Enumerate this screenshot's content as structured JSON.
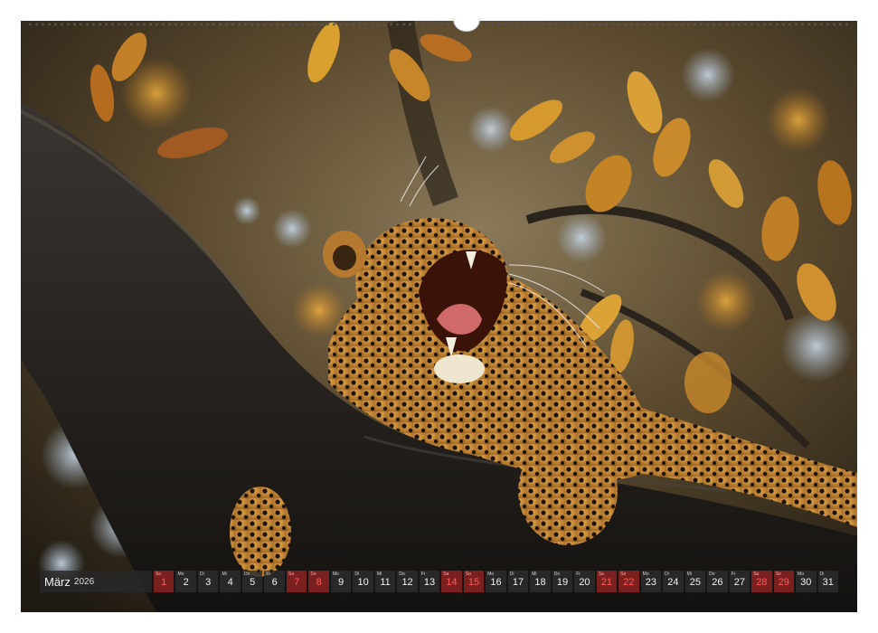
{
  "calendar": {
    "month": "März",
    "year": "2026",
    "days": [
      {
        "wd": "So",
        "num": "1",
        "sunday": true
      },
      {
        "wd": "Mo",
        "num": "2",
        "sunday": false
      },
      {
        "wd": "Di",
        "num": "3",
        "sunday": false
      },
      {
        "wd": "Mi",
        "num": "4",
        "sunday": false
      },
      {
        "wd": "Do",
        "num": "5",
        "sunday": false
      },
      {
        "wd": "Fr",
        "num": "6",
        "sunday": false
      },
      {
        "wd": "Sa",
        "num": "7",
        "sunday": true
      },
      {
        "wd": "So",
        "num": "8",
        "sunday": true
      },
      {
        "wd": "Mo",
        "num": "9",
        "sunday": false
      },
      {
        "wd": "Di",
        "num": "10",
        "sunday": false
      },
      {
        "wd": "Mi",
        "num": "11",
        "sunday": false
      },
      {
        "wd": "Do",
        "num": "12",
        "sunday": false
      },
      {
        "wd": "Fr",
        "num": "13",
        "sunday": false
      },
      {
        "wd": "Sa",
        "num": "14",
        "sunday": true
      },
      {
        "wd": "So",
        "num": "15",
        "sunday": true
      },
      {
        "wd": "Mo",
        "num": "16",
        "sunday": false
      },
      {
        "wd": "Di",
        "num": "17",
        "sunday": false
      },
      {
        "wd": "Mi",
        "num": "18",
        "sunday": false
      },
      {
        "wd": "Do",
        "num": "19",
        "sunday": false
      },
      {
        "wd": "Fr",
        "num": "20",
        "sunday": false
      },
      {
        "wd": "Sa",
        "num": "21",
        "sunday": true
      },
      {
        "wd": "So",
        "num": "22",
        "sunday": true
      },
      {
        "wd": "Mo",
        "num": "23",
        "sunday": false
      },
      {
        "wd": "Di",
        "num": "24",
        "sunday": false
      },
      {
        "wd": "Mi",
        "num": "25",
        "sunday": false
      },
      {
        "wd": "Do",
        "num": "26",
        "sunday": false
      },
      {
        "wd": "Fr",
        "num": "27",
        "sunday": false
      },
      {
        "wd": "Sa",
        "num": "28",
        "sunday": true
      },
      {
        "wd": "So",
        "num": "29",
        "sunday": true
      },
      {
        "wd": "Mo",
        "num": "30",
        "sunday": false
      },
      {
        "wd": "Di",
        "num": "31",
        "sunday": false
      }
    ]
  },
  "colors": {
    "sunday_text": "#ff5b5b",
    "leaf_gold": "#d9a030",
    "leopard_coat": "#c98a34"
  },
  "image": {
    "subject": "leopard-yawning-on-tree-branch"
  }
}
